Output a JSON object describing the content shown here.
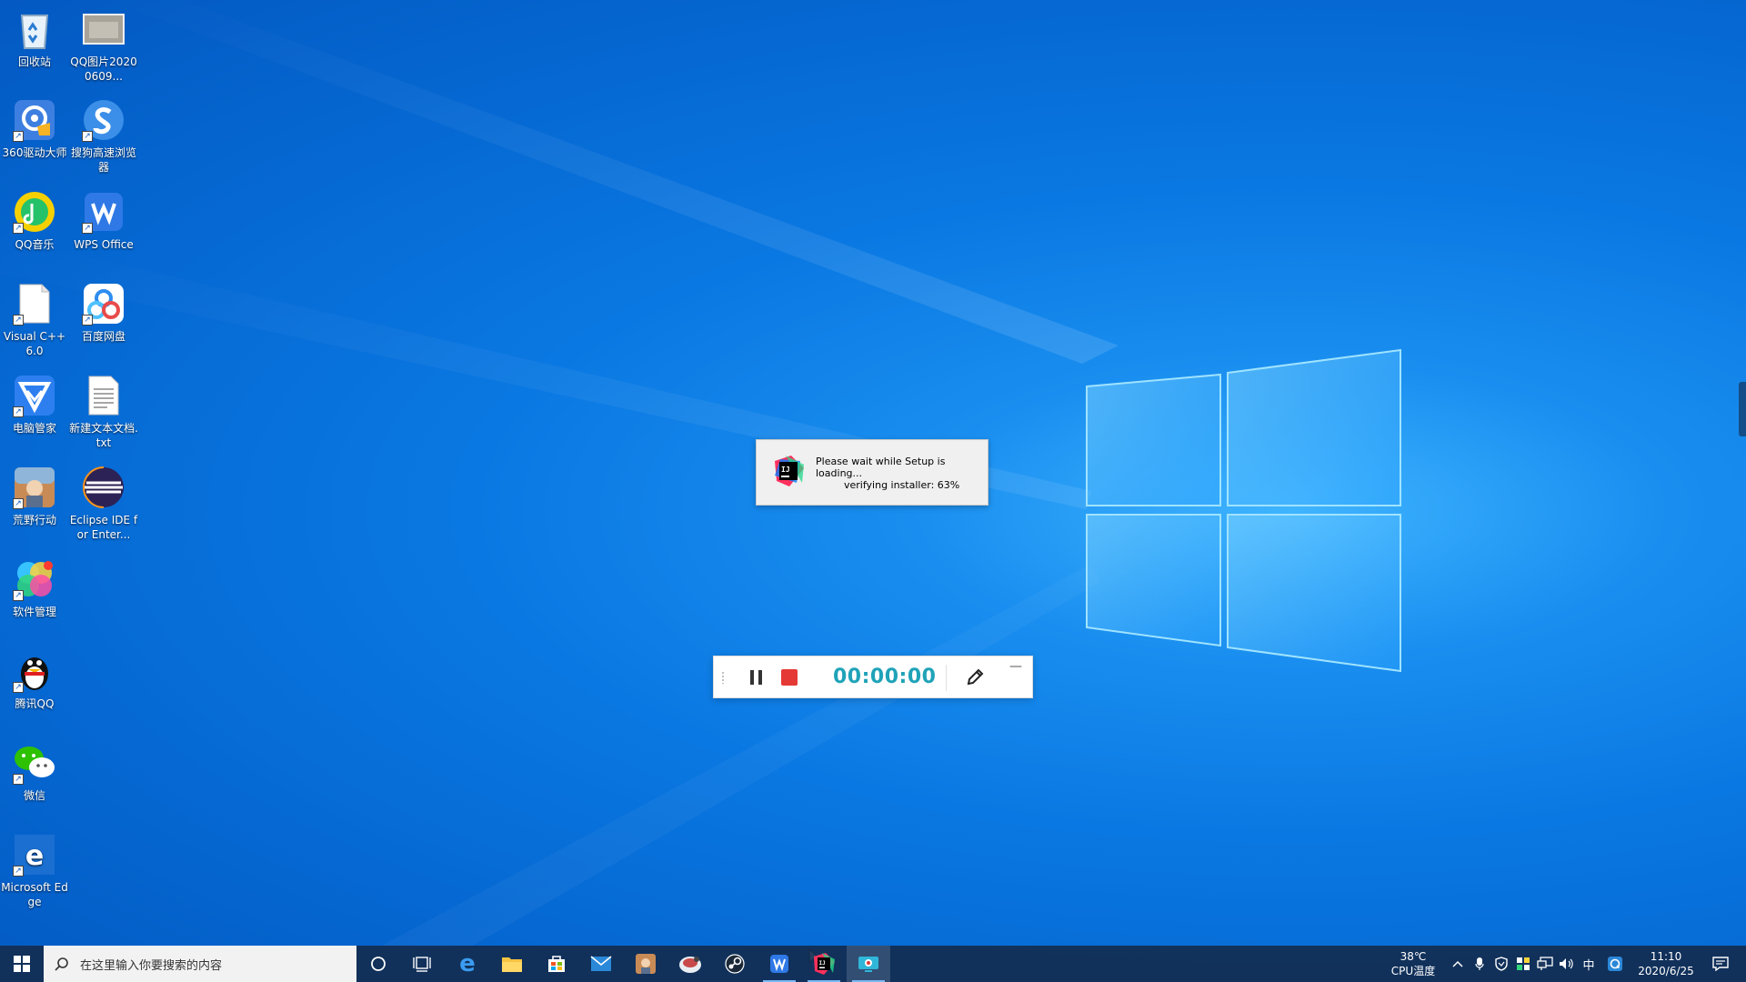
{
  "desktop": {
    "icons": [
      {
        "label": "回收站",
        "icon": "recycle-bin-icon"
      },
      {
        "label": "QQ图片20200609...",
        "icon": "image-file-icon"
      },
      {
        "label": "360驱动大师",
        "icon": "360-driver-icon"
      },
      {
        "label": "搜狗高速浏览器",
        "icon": "sogou-browser-icon"
      },
      {
        "label": "QQ音乐",
        "icon": "qq-music-icon"
      },
      {
        "label": "WPS Office",
        "icon": "wps-office-icon"
      },
      {
        "label": "Visual C++ 6.0",
        "icon": "blank-document-icon"
      },
      {
        "label": "百度网盘",
        "icon": "baidu-netdisk-icon"
      },
      {
        "label": "电脑管家",
        "icon": "pc-manager-icon"
      },
      {
        "label": "新建文本文档.txt",
        "icon": "text-file-icon"
      },
      {
        "label": "荒野行动",
        "icon": "game-icon"
      },
      {
        "label": "Eclipse IDE for Enter...",
        "icon": "eclipse-icon"
      },
      {
        "label": "软件管理",
        "icon": "software-manager-icon"
      },
      {
        "label": "腾讯QQ",
        "icon": "qq-penguin-icon"
      },
      {
        "label": "微信",
        "icon": "wechat-icon"
      },
      {
        "label": "Microsoft Edge",
        "icon": "edge-icon"
      }
    ]
  },
  "setup_dialog": {
    "line1": "Please wait while Setup is loading...",
    "line2": "verifying installer: 63%"
  },
  "recorder": {
    "timer": "00:00:00",
    "accent": "#1fa3b8",
    "stop_color": "#e53935"
  },
  "taskbar": {
    "search_placeholder": "在这里输入你要搜索的内容",
    "apps": [
      "cortana-icon",
      "task-view-icon",
      "edge-icon",
      "file-explorer-icon",
      "store-icon",
      "mail-icon",
      "game-icon",
      "app-icon",
      "steam-icon",
      "wps-icon",
      "intellij-icon",
      "screen-recorder-icon"
    ],
    "cpu_temp": "38℃",
    "cpu_label": "CPU温度",
    "ime": "中",
    "time": "11:10",
    "date": "2020/6/25"
  }
}
